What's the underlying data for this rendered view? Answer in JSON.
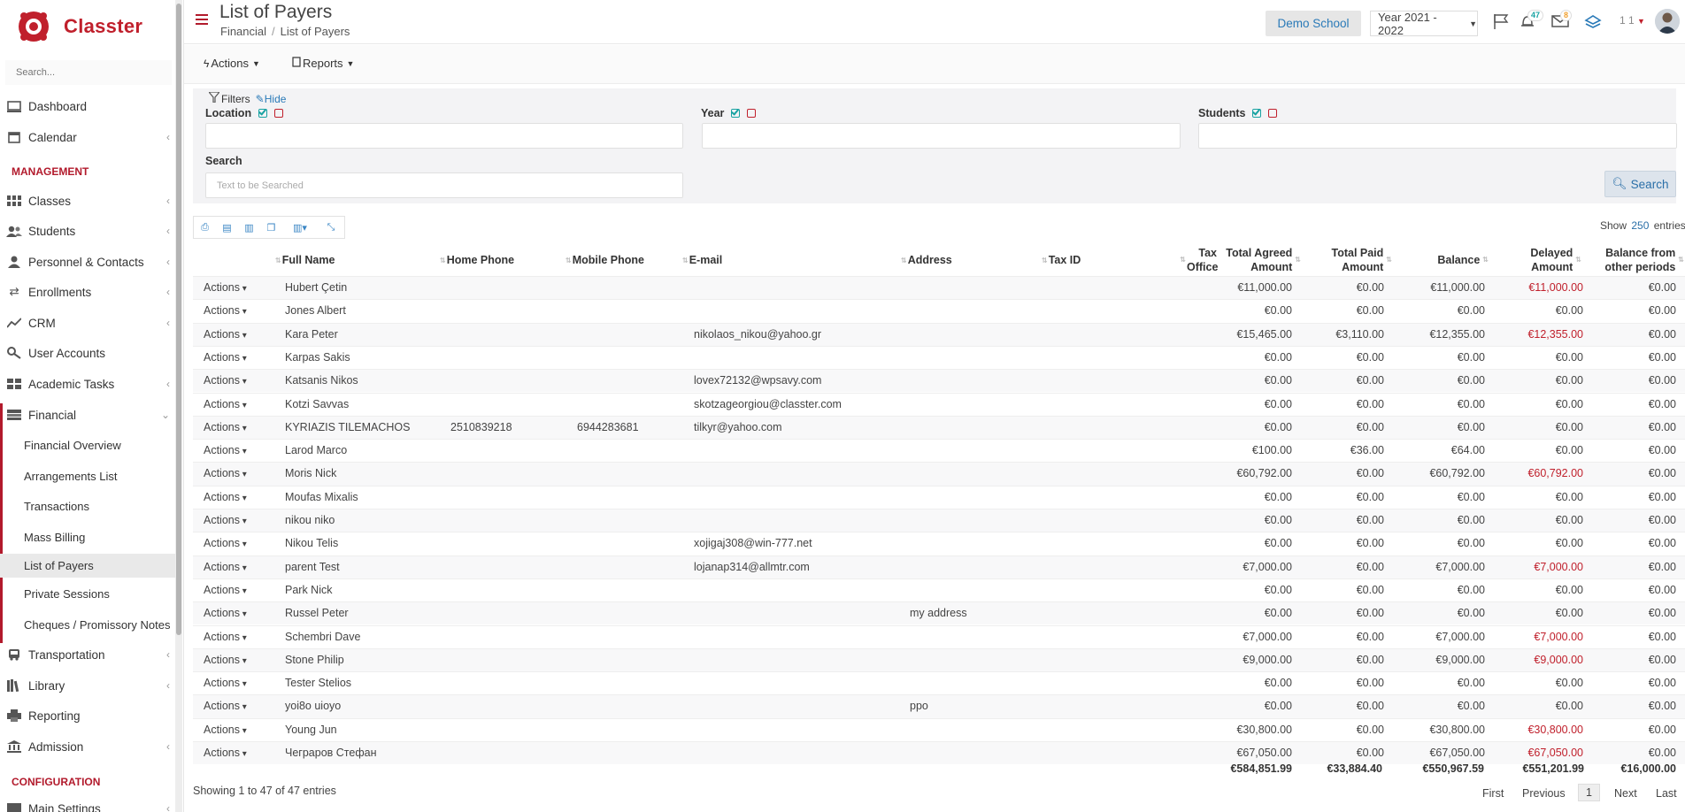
{
  "app": {
    "name": "Classter",
    "search_placeholder": "Search..."
  },
  "sidebar": {
    "items": [
      {
        "label": "Dashboard",
        "icon": "monitor-icon"
      },
      {
        "label": "Calendar",
        "icon": "calendar-icon"
      }
    ],
    "management_title": "MANAGEMENT",
    "management": [
      {
        "label": "Classes"
      },
      {
        "label": "Students"
      },
      {
        "label": "Personnel & Contacts"
      },
      {
        "label": "Enrollments"
      },
      {
        "label": "CRM"
      },
      {
        "label": "User Accounts"
      },
      {
        "label": "Academic Tasks"
      },
      {
        "label": "Financial"
      }
    ],
    "financial_sub": [
      {
        "label": "Financial Overview"
      },
      {
        "label": "Arrangements List"
      },
      {
        "label": "Transactions"
      },
      {
        "label": "Mass Billing"
      },
      {
        "label": "List of Payers"
      },
      {
        "label": "Private Sessions"
      },
      {
        "label": "Cheques / Promissory Notes"
      }
    ],
    "after": [
      {
        "label": "Transportation"
      },
      {
        "label": "Library"
      },
      {
        "label": "Reporting"
      },
      {
        "label": "Admission"
      }
    ],
    "configuration_title": "CONFIGURATION",
    "config": [
      {
        "label": "Main Settings"
      }
    ]
  },
  "header": {
    "title": "List of Payers",
    "breadcrumb": [
      "Financial",
      "List of Payers"
    ],
    "school": "Demo School",
    "year": "Year 2021 - 2022",
    "notifications": "47",
    "messages": "8",
    "user": "1 1"
  },
  "actions": {
    "actions_label": "Actions",
    "reports_label": "Reports"
  },
  "filters": {
    "title": "Filters",
    "hide": "Hide",
    "location": "Location",
    "year": "Year",
    "students": "Students",
    "search_label": "Search",
    "search_placeholder": "Text to be Searched",
    "search_button": "Search"
  },
  "table": {
    "show_label": "Show",
    "show_count": "250",
    "show_suffix": "entries",
    "columns": [
      "Full Name",
      "Home Phone",
      "Mobile Phone",
      "E-mail",
      "Address",
      "Tax ID",
      "Tax Office",
      "Total Agreed Amount",
      "Total Paid Amount",
      "Balance",
      "Delayed Amount",
      "Balance from other periods"
    ],
    "action_label": "Actions",
    "rows": [
      {
        "name": "Hubert Çetin",
        "home": "",
        "mobile": "",
        "email": "",
        "address": "",
        "agreed": "€11,000.00",
        "paid": "€0.00",
        "balance": "€11,000.00",
        "delayed": "€11,000.00",
        "other": "€0.00"
      },
      {
        "name": "Jones Albert",
        "home": "",
        "mobile": "",
        "email": "",
        "address": "",
        "agreed": "€0.00",
        "paid": "€0.00",
        "balance": "€0.00",
        "delayed": "€0.00",
        "other": "€0.00"
      },
      {
        "name": "Kara Peter",
        "home": "",
        "mobile": "",
        "email": "nikolaos_nikou@yahoo.gr",
        "address": "",
        "agreed": "€15,465.00",
        "paid": "€3,110.00",
        "balance": "€12,355.00",
        "delayed": "€12,355.00",
        "other": "€0.00"
      },
      {
        "name": "Karpas Sakis",
        "home": "",
        "mobile": "",
        "email": "",
        "address": "",
        "agreed": "€0.00",
        "paid": "€0.00",
        "balance": "€0.00",
        "delayed": "€0.00",
        "other": "€0.00"
      },
      {
        "name": "Katsanis Nikos",
        "home": "",
        "mobile": "",
        "email": "lovex72132@wpsavy.com",
        "address": "",
        "agreed": "€0.00",
        "paid": "€0.00",
        "balance": "€0.00",
        "delayed": "€0.00",
        "other": "€0.00"
      },
      {
        "name": "Kotzi Savvas",
        "home": "",
        "mobile": "",
        "email": "skotzageorgiou@classter.com",
        "address": "",
        "agreed": "€0.00",
        "paid": "€0.00",
        "balance": "€0.00",
        "delayed": "€0.00",
        "other": "€0.00"
      },
      {
        "name": "KYRIAZIS TILEMACHOS",
        "home": "2510839218",
        "mobile": "6944283681",
        "email": "tilkyr@yahoo.com",
        "address": "",
        "agreed": "€0.00",
        "paid": "€0.00",
        "balance": "€0.00",
        "delayed": "€0.00",
        "other": "€0.00"
      },
      {
        "name": "Larod Marco",
        "home": "",
        "mobile": "",
        "email": "",
        "address": "",
        "agreed": "€100.00",
        "paid": "€36.00",
        "balance": "€64.00",
        "delayed": "€0.00",
        "other": "€0.00"
      },
      {
        "name": "Moris Nick",
        "home": "",
        "mobile": "",
        "email": "",
        "address": "",
        "agreed": "€60,792.00",
        "paid": "€0.00",
        "balance": "€60,792.00",
        "delayed": "€60,792.00",
        "other": "€0.00"
      },
      {
        "name": "Moufas Mixalis",
        "home": "",
        "mobile": "",
        "email": "",
        "address": "",
        "agreed": "€0.00",
        "paid": "€0.00",
        "balance": "€0.00",
        "delayed": "€0.00",
        "other": "€0.00"
      },
      {
        "name": "nikou niko",
        "home": "",
        "mobile": "",
        "email": "",
        "address": "",
        "agreed": "€0.00",
        "paid": "€0.00",
        "balance": "€0.00",
        "delayed": "€0.00",
        "other": "€0.00"
      },
      {
        "name": "Nikou Telis",
        "home": "",
        "mobile": "",
        "email": "xojigaj308@win-777.net",
        "address": "",
        "agreed": "€0.00",
        "paid": "€0.00",
        "balance": "€0.00",
        "delayed": "€0.00",
        "other": "€0.00"
      },
      {
        "name": "parent Test",
        "home": "",
        "mobile": "",
        "email": "lojanap314@allmtr.com",
        "address": "",
        "agreed": "€7,000.00",
        "paid": "€0.00",
        "balance": "€7,000.00",
        "delayed": "€7,000.00",
        "other": "€0.00"
      },
      {
        "name": "Park Nick",
        "home": "",
        "mobile": "",
        "email": "",
        "address": "",
        "agreed": "€0.00",
        "paid": "€0.00",
        "balance": "€0.00",
        "delayed": "€0.00",
        "other": "€0.00"
      },
      {
        "name": "Russel Peter",
        "home": "",
        "mobile": "",
        "email": "",
        "address": "my address",
        "agreed": "€0.00",
        "paid": "€0.00",
        "balance": "€0.00",
        "delayed": "€0.00",
        "other": "€0.00"
      },
      {
        "name": "Schembri Dave",
        "home": "",
        "mobile": "",
        "email": "",
        "address": "",
        "agreed": "€7,000.00",
        "paid": "€0.00",
        "balance": "€7,000.00",
        "delayed": "€7,000.00",
        "other": "€0.00"
      },
      {
        "name": "Stone Philip",
        "home": "",
        "mobile": "",
        "email": "",
        "address": "",
        "agreed": "€9,000.00",
        "paid": "€0.00",
        "balance": "€9,000.00",
        "delayed": "€9,000.00",
        "other": "€0.00"
      },
      {
        "name": "Tester Stelios",
        "home": "",
        "mobile": "",
        "email": "",
        "address": "",
        "agreed": "€0.00",
        "paid": "€0.00",
        "balance": "€0.00",
        "delayed": "€0.00",
        "other": "€0.00"
      },
      {
        "name": "yoi8o uioyo",
        "home": "",
        "mobile": "",
        "email": "",
        "address": "ppo",
        "agreed": "€0.00",
        "paid": "€0.00",
        "balance": "€0.00",
        "delayed": "€0.00",
        "other": "€0.00"
      },
      {
        "name": "Young Jun",
        "home": "",
        "mobile": "",
        "email": "",
        "address": "",
        "agreed": "€30,800.00",
        "paid": "€0.00",
        "balance": "€30,800.00",
        "delayed": "€30,800.00",
        "other": "€0.00"
      },
      {
        "name": "Чеграров Стефан",
        "home": "",
        "mobile": "",
        "email": "",
        "address": "",
        "agreed": "€67,050.00",
        "paid": "€0.00",
        "balance": "€67,050.00",
        "delayed": "€67,050.00",
        "other": "€0.00"
      }
    ],
    "totals": {
      "agreed": "€584,851.99",
      "paid": "€33,884.40",
      "balance": "€550,967.59",
      "delayed": "€551,201.99",
      "other": "€16,000.00"
    },
    "info": "Showing 1 to 47 of 47 entries",
    "pagination": {
      "first": "First",
      "previous": "Previous",
      "current": "1",
      "next": "Next",
      "last": "Last"
    }
  },
  "colors": {
    "brand": "#c0202c",
    "link": "#2a6fa8",
    "accent": "#17a2a2"
  }
}
